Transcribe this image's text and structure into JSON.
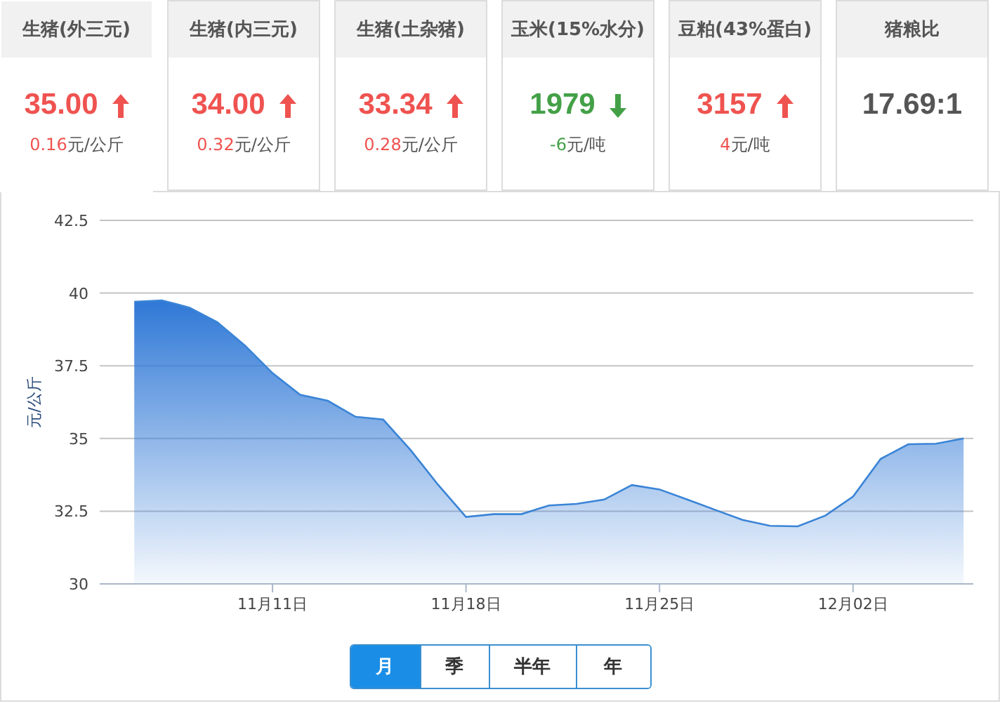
{
  "cards": [
    {
      "title": "生猪(外三元)",
      "value": "35.00",
      "kind": "up",
      "change": "0.16",
      "unit": "元/公斤",
      "selected": true
    },
    {
      "title": "生猪(内三元)",
      "value": "34.00",
      "kind": "up",
      "change": "0.32",
      "unit": "元/公斤",
      "selected": false
    },
    {
      "title": "生猪(土杂猪)",
      "value": "33.34",
      "kind": "up",
      "change": "0.28",
      "unit": "元/公斤",
      "selected": false
    },
    {
      "title": "玉米(15%水分)",
      "value": "1979",
      "kind": "down",
      "change": "-6",
      "unit": "元/吨",
      "selected": false
    },
    {
      "title": "豆粕(43%蛋白)",
      "value": "3157",
      "kind": "up",
      "change": "4",
      "unit": "元/吨",
      "selected": false
    },
    {
      "title": "猪粮比",
      "value": "17.69:1",
      "kind": "ratio",
      "selected": false
    }
  ],
  "chart": {
    "chart_data": {
      "type": "area",
      "ylabel": "元/公斤",
      "categories": [
        null,
        null,
        null,
        null,
        null,
        "11月11日",
        null,
        null,
        null,
        null,
        null,
        null,
        "11月18日",
        null,
        null,
        null,
        null,
        null,
        null,
        "11月25日",
        null,
        null,
        null,
        null,
        null,
        null,
        "12月02日",
        null,
        null,
        null,
        null
      ],
      "series": [
        {
          "color": "#3a84d6",
          "values": [
            39.7,
            39.75,
            39.5,
            39.0,
            38.2,
            37.25,
            36.5,
            36.3,
            35.75,
            35.65,
            34.6,
            33.4,
            32.3,
            32.4,
            32.4,
            32.7,
            32.75,
            32.9,
            33.4,
            33.25,
            32.9,
            32.55,
            32.2,
            32.0,
            31.98,
            32.35,
            33.0,
            34.3,
            34.8,
            34.82,
            35.0
          ]
        }
      ],
      "ylim": [
        30,
        42.5
      ],
      "grid": true,
      "yticks": [
        {
          "value": 30,
          "label": "30"
        },
        {
          "value": 32.5,
          "label": "32.5"
        },
        {
          "value": 35,
          "label": "35"
        },
        {
          "value": 37.5,
          "label": "37.5"
        },
        {
          "value": 40,
          "label": "40"
        },
        {
          "value": 42.5,
          "label": "42.5"
        }
      ]
    }
  },
  "ranges": [
    {
      "label": "月",
      "selected": true
    },
    {
      "label": "季",
      "selected": false
    },
    {
      "label": "半年",
      "selected": false
    },
    {
      "label": "年",
      "selected": false
    }
  ]
}
